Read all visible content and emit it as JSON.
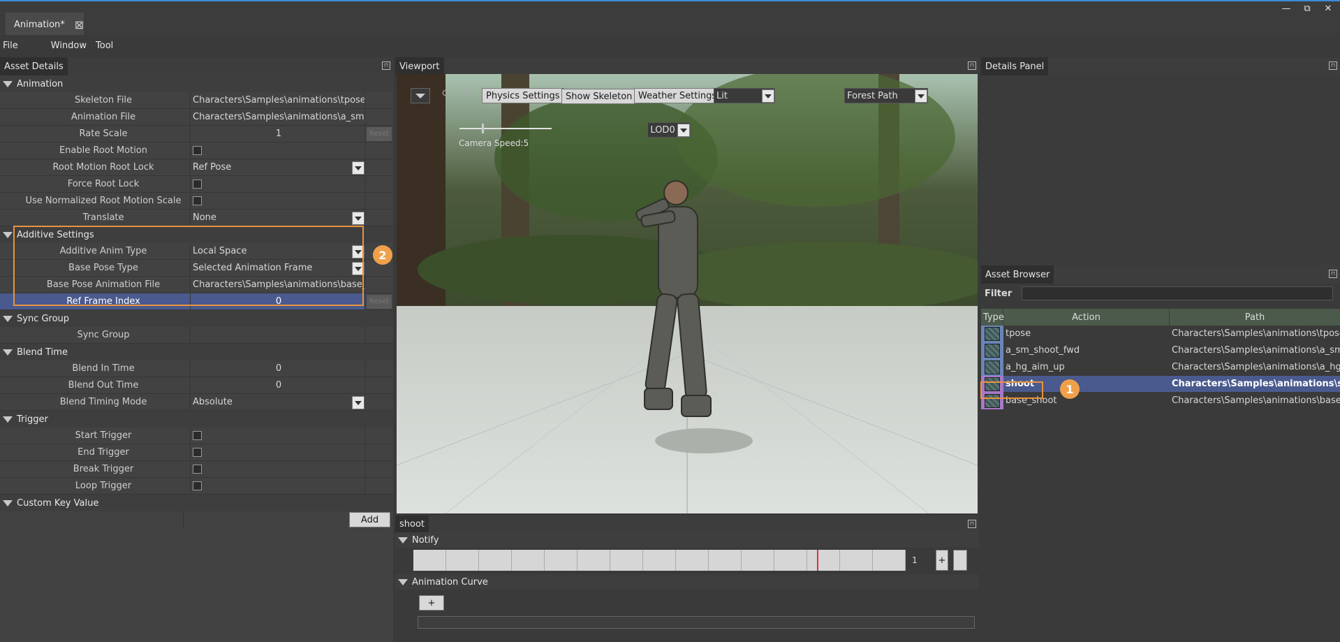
{
  "window": {
    "tab_title": "Animation*",
    "minimize": "—",
    "restore": "⧉",
    "close": "✕"
  },
  "menu": [
    "File",
    "Window",
    "Tool"
  ],
  "asset_details": {
    "title": "Asset Details",
    "sections": {
      "animation": "Animation",
      "additive": "Additive Settings",
      "sync": "Sync Group",
      "blend": "Blend Time",
      "trigger": "Trigger",
      "custom": "Custom Key Value"
    },
    "rows": {
      "skeleton_file": {
        "label": "Skeleton File",
        "value": "Characters\\Samples\\animations\\tpose.x..."
      },
      "animation_file": {
        "label": "Animation File",
        "value": "Characters\\Samples\\animations\\a_sm_s..."
      },
      "rate_scale": {
        "label": "Rate Scale",
        "value": "1",
        "reset": "Reset"
      },
      "enable_root_motion": {
        "label": "Enable Root Motion"
      },
      "root_motion_root_lock": {
        "label": "Root Motion Root Lock",
        "value": "Ref Pose"
      },
      "force_root_lock": {
        "label": "Force Root Lock"
      },
      "use_normalized": {
        "label": "Use Normalized Root Motion Scale"
      },
      "translate": {
        "label": "Translate",
        "value": "None"
      },
      "additive_anim_type": {
        "label": "Additive Anim Type",
        "value": "Local Space"
      },
      "base_pose_type": {
        "label": "Base Pose Type",
        "value": "Selected Animation Frame"
      },
      "base_pose_file": {
        "label": "Base Pose Animation File",
        "value": "Characters\\Samples\\animations\\base_s..."
      },
      "ref_frame_index": {
        "label": "Ref Frame Index",
        "value": "0",
        "reset": "Reset"
      },
      "sync_group": {
        "label": "Sync Group",
        "value": ""
      },
      "blend_in": {
        "label": "Blend In Time",
        "value": "0"
      },
      "blend_out": {
        "label": "Blend Out Time",
        "value": "0"
      },
      "blend_mode": {
        "label": "Blend Timing Mode",
        "value": "Absolute"
      },
      "start_trigger": {
        "label": "Start Trigger"
      },
      "end_trigger": {
        "label": "End Trigger"
      },
      "break_trigger": {
        "label": "Break Trigger"
      },
      "loop_trigger": {
        "label": "Loop Trigger"
      }
    },
    "add_button": "Add",
    "badge2": "2"
  },
  "viewport": {
    "title": "Viewport",
    "physics": "Physics Settings",
    "show_skeleton": "Show Skeleton",
    "weather": "Weather Settings",
    "lit": "Lit",
    "scene": "Forest Path",
    "extra": "",
    "lod": "LOD0",
    "camera_speed": "Camera Speed:5"
  },
  "timeline": {
    "tab": "shoot",
    "notify": "Notify",
    "frame_count": "1",
    "plus": "+",
    "curve": "Animation Curve",
    "curve_add": "+"
  },
  "details_panel": {
    "title": "Details Panel"
  },
  "asset_browser": {
    "title": "Asset Browser",
    "filter_label": "Filter",
    "filter_value": "",
    "columns": [
      "Type",
      "Action",
      "Path"
    ],
    "rows": [
      {
        "action": "tpose",
        "path": "Characters\\Samples\\animations\\tpose...."
      },
      {
        "action": "a_sm_shoot_fwd",
        "path": "Characters\\Samples\\animations\\a_sm..."
      },
      {
        "action": "a_hg_aim_up",
        "path": "Characters\\Samples\\animations\\a_hg_..."
      },
      {
        "action": "shoot",
        "path": "Characters\\Samples\\animations\\shoot...."
      },
      {
        "action": "base_shoot",
        "path": "Characters\\Samples\\animations\\base_..."
      }
    ],
    "badge1": "1"
  }
}
